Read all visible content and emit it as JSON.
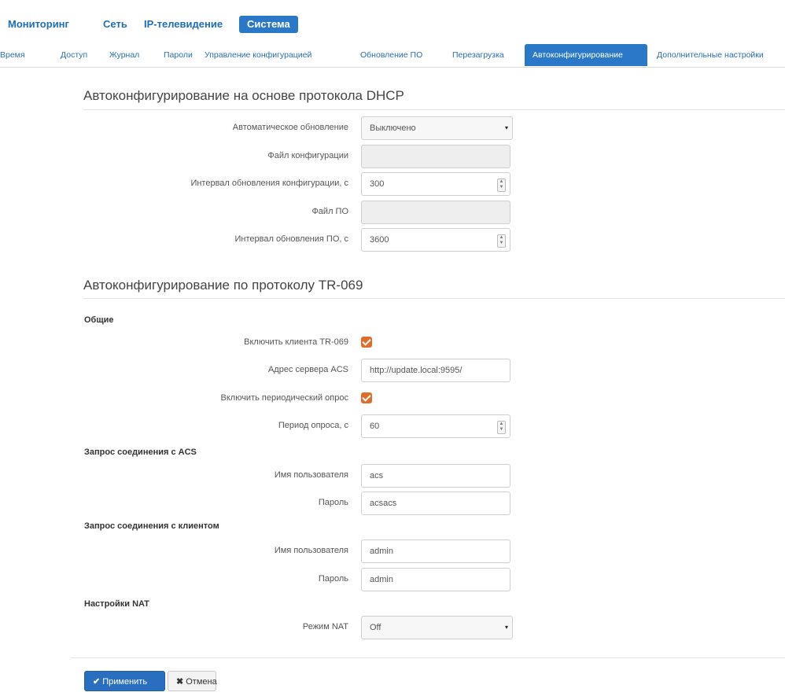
{
  "topnav": [
    "Мониторинг",
    "Сеть",
    "IP-телевидение",
    "Система"
  ],
  "subnav": [
    "Время",
    "Доступ",
    "Журнал",
    "Пароли",
    "Управление конфигурацией",
    "Обновление ПО",
    "Перезагрузка",
    "Автоконфигурирование",
    "Дополнительные настройки"
  ],
  "dhcp": {
    "title": "Автоконфигурирование на основе протокола DHCP",
    "auto_update_label": "Автоматическое обновление",
    "auto_update_value": "Выключено",
    "config_file_label": "Файл конфигурации",
    "config_interval_label": "Интервал обновления конфигурации, с",
    "config_interval_value": "300",
    "fw_file_label": "Файл ПО",
    "fw_interval_label": "Интервал обновления ПО, с",
    "fw_interval_value": "3600"
  },
  "tr069": {
    "title": "Автоконфигурирование по протоколу TR-069",
    "general_label": "Общие",
    "enable_client_label": "Включить клиента TR-069",
    "acs_address_label": "Адрес сервера ACS",
    "acs_address_value": "http://update.local:9595/",
    "periodic_label": "Включить периодический опрос",
    "period_label": "Период опроса, с",
    "period_value": "60",
    "acs_request_label": "Запрос соединения с ACS",
    "acs_user_label": "Имя пользователя",
    "acs_user_value": "acs",
    "acs_pass_label": "Пароль",
    "acs_pass_value": "acsacs",
    "client_request_label": "Запрос соединения с клиентом",
    "client_user_label": "Имя пользователя",
    "client_user_value": "admin",
    "client_pass_label": "Пароль",
    "client_pass_value": "admin",
    "nat_label": "Настройки NAT",
    "nat_mode_label": "Режим NAT",
    "nat_mode_value": "Off"
  },
  "buttons": {
    "apply": "Применить",
    "cancel": "Отмена"
  },
  "colors": {
    "accent": "#2a78c7",
    "checkbox": "#e16b2a"
  },
  "icons": {
    "apply": "check-icon",
    "cancel": "x-icon",
    "spin": "spinner-arrows-icon"
  }
}
